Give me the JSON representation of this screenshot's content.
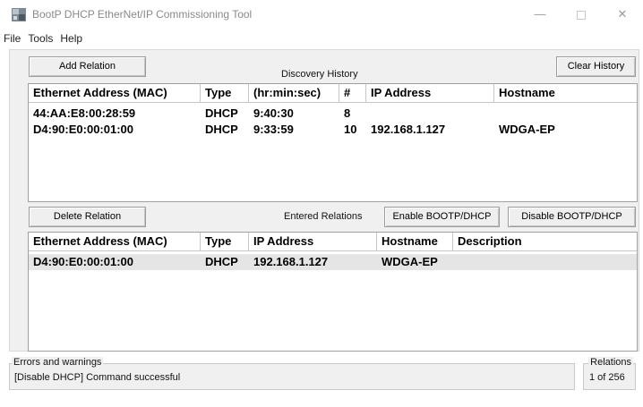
{
  "window": {
    "title": "BootP DHCP EtherNet/IP Commissioning Tool",
    "min_glyph": "—",
    "close_glyph": "✕"
  },
  "menu": [
    "File",
    "Tools",
    "Help"
  ],
  "discovery": {
    "add_button": "Add Relation",
    "caption": "Discovery History",
    "clear_button": "Clear History",
    "columns": [
      "Ethernet Address (MAC)",
      "Type",
      "(hr:min:sec)",
      "#",
      "IP Address",
      "Hostname"
    ],
    "rows": [
      [
        "44:AA:E8:00:28:59",
        "DHCP",
        "9:40:30",
        "8",
        "",
        ""
      ],
      [
        "D4:90:E0:00:01:00",
        "DHCP",
        "9:33:59",
        "10",
        "192.168.1.127",
        "WDGA-EP"
      ]
    ]
  },
  "relations": {
    "delete_button": "Delete Relation",
    "caption": "Entered Relations",
    "enable_button": "Enable BOOTP/DHCP",
    "disable_button": "Disable BOOTP/DHCP",
    "columns": [
      "Ethernet Address (MAC)",
      "Type",
      "IP Address",
      "Hostname",
      "Description"
    ],
    "rows": [
      [
        "D4:90:E0:00:01:00",
        "DHCP",
        "192.168.1.127",
        "WDGA-EP",
        ""
      ]
    ]
  },
  "status": {
    "errors_label": "Errors and warnings",
    "errors_text": "[Disable DHCP] Command successful",
    "relations_label": "Relations",
    "relations_count": "1 of 256"
  },
  "colors": {
    "selected_row": "#e5e5e5",
    "client_bg": "#f0f0f0"
  }
}
